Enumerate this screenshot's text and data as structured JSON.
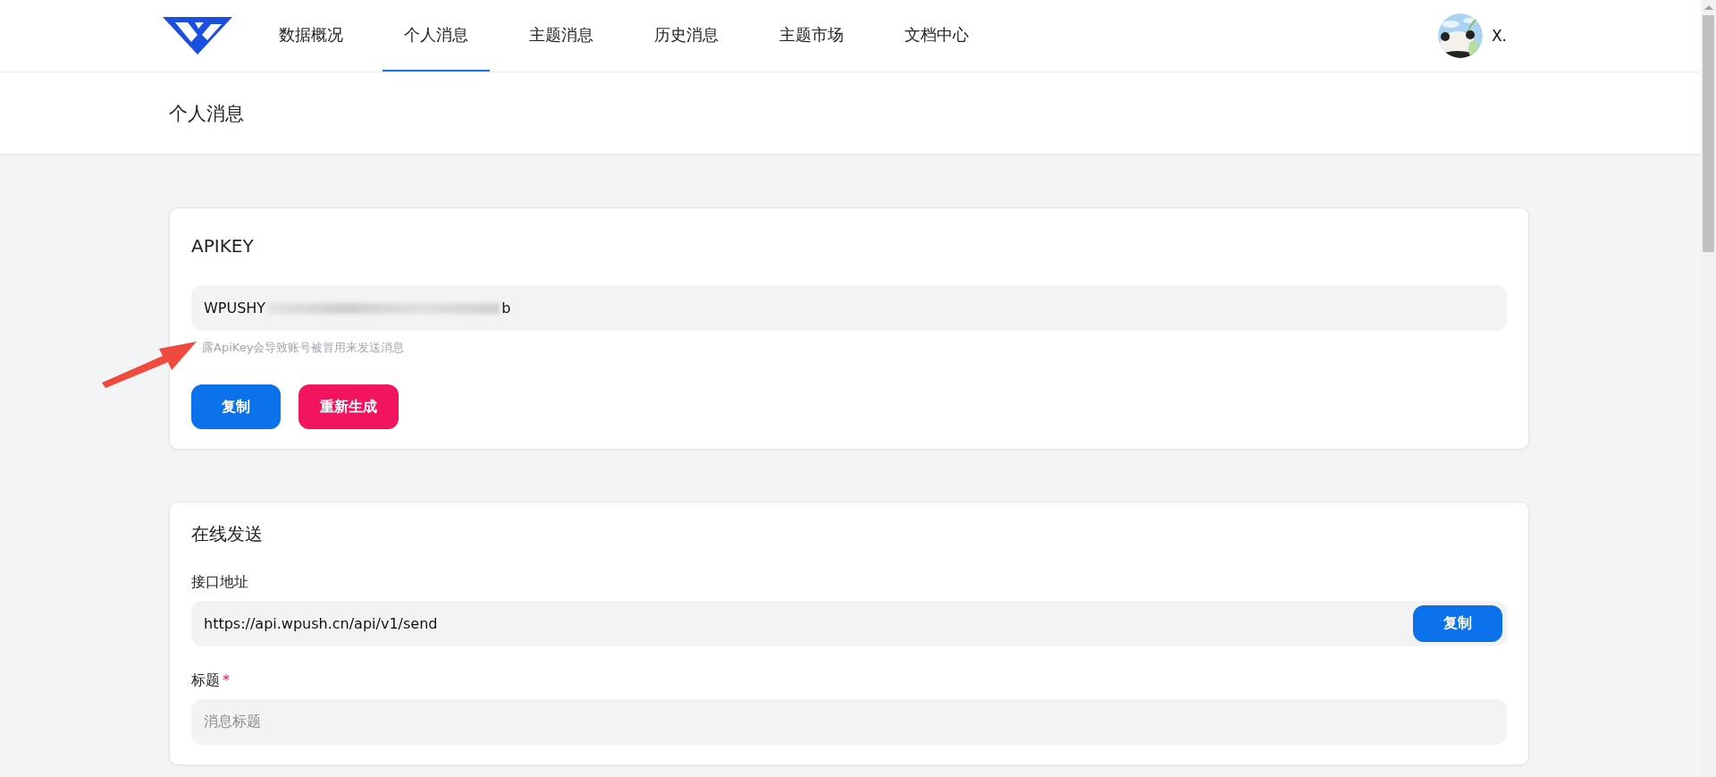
{
  "nav": {
    "items": [
      {
        "label": "数据概况",
        "selected": false
      },
      {
        "label": "个人消息",
        "selected": true
      },
      {
        "label": "主题消息",
        "selected": false
      },
      {
        "label": "历史消息",
        "selected": false
      },
      {
        "label": "主题市场",
        "selected": false
      },
      {
        "label": "文档中心",
        "selected": false
      }
    ],
    "user": {
      "name": "X."
    }
  },
  "page_title": "个人消息",
  "apikey_card": {
    "title": "APIKEY",
    "key_start": "WPUSHY",
    "key_end": "b",
    "redacted": true,
    "hint": "露ApiKey会导致账号被冒用来发送消息",
    "buttons": [
      {
        "label": "复制",
        "kind": "primary"
      },
      {
        "label": "重新生成",
        "kind": "danger"
      }
    ]
  },
  "annotation": {
    "kind": "arrow"
  },
  "send_card": {
    "title": "在线发送",
    "fields": [
      {
        "label": "接口地址",
        "value": "https://api.wpush.cn/api/v1/send",
        "button": "复制"
      },
      {
        "label": "标题",
        "required_mark": "*",
        "placeholder": "消息标题"
      }
    ]
  }
}
